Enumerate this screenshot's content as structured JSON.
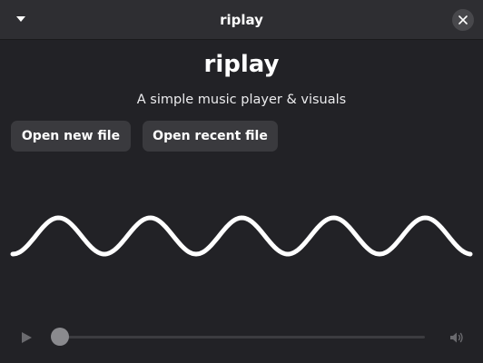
{
  "window": {
    "title": "riplay"
  },
  "header": {
    "menu_icon": "chevron-down-icon",
    "close_icon": "close-icon"
  },
  "main": {
    "heading": "riplay",
    "subtitle": "A simple music player & visuals",
    "buttons": {
      "open_new": "Open new file",
      "open_recent": "Open recent file"
    }
  },
  "player": {
    "play_icon": "play-icon",
    "volume_icon": "volume-icon",
    "position": 0
  },
  "colors": {
    "background": "#222226",
    "titlebar": "#2e2e32",
    "button": "#3a3a3e",
    "waveform": "#ffffff",
    "disabled_icon": "#6a6a6e"
  }
}
